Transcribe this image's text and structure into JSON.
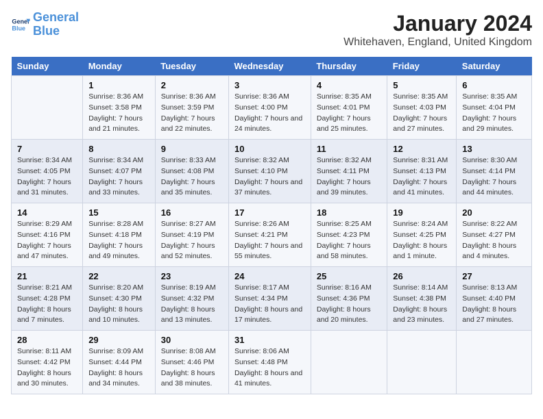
{
  "header": {
    "logo_line1": "General",
    "logo_line2": "Blue",
    "main_title": "January 2024",
    "subtitle": "Whitehaven, England, United Kingdom"
  },
  "columns": [
    "Sunday",
    "Monday",
    "Tuesday",
    "Wednesday",
    "Thursday",
    "Friday",
    "Saturday"
  ],
  "weeks": [
    [
      {
        "num": "",
        "sunrise": "",
        "sunset": "",
        "daylight": ""
      },
      {
        "num": "1",
        "sunrise": "Sunrise: 8:36 AM",
        "sunset": "Sunset: 3:58 PM",
        "daylight": "Daylight: 7 hours and 21 minutes."
      },
      {
        "num": "2",
        "sunrise": "Sunrise: 8:36 AM",
        "sunset": "Sunset: 3:59 PM",
        "daylight": "Daylight: 7 hours and 22 minutes."
      },
      {
        "num": "3",
        "sunrise": "Sunrise: 8:36 AM",
        "sunset": "Sunset: 4:00 PM",
        "daylight": "Daylight: 7 hours and 24 minutes."
      },
      {
        "num": "4",
        "sunrise": "Sunrise: 8:35 AM",
        "sunset": "Sunset: 4:01 PM",
        "daylight": "Daylight: 7 hours and 25 minutes."
      },
      {
        "num": "5",
        "sunrise": "Sunrise: 8:35 AM",
        "sunset": "Sunset: 4:03 PM",
        "daylight": "Daylight: 7 hours and 27 minutes."
      },
      {
        "num": "6",
        "sunrise": "Sunrise: 8:35 AM",
        "sunset": "Sunset: 4:04 PM",
        "daylight": "Daylight: 7 hours and 29 minutes."
      }
    ],
    [
      {
        "num": "7",
        "sunrise": "Sunrise: 8:34 AM",
        "sunset": "Sunset: 4:05 PM",
        "daylight": "Daylight: 7 hours and 31 minutes."
      },
      {
        "num": "8",
        "sunrise": "Sunrise: 8:34 AM",
        "sunset": "Sunset: 4:07 PM",
        "daylight": "Daylight: 7 hours and 33 minutes."
      },
      {
        "num": "9",
        "sunrise": "Sunrise: 8:33 AM",
        "sunset": "Sunset: 4:08 PM",
        "daylight": "Daylight: 7 hours and 35 minutes."
      },
      {
        "num": "10",
        "sunrise": "Sunrise: 8:32 AM",
        "sunset": "Sunset: 4:10 PM",
        "daylight": "Daylight: 7 hours and 37 minutes."
      },
      {
        "num": "11",
        "sunrise": "Sunrise: 8:32 AM",
        "sunset": "Sunset: 4:11 PM",
        "daylight": "Daylight: 7 hours and 39 minutes."
      },
      {
        "num": "12",
        "sunrise": "Sunrise: 8:31 AM",
        "sunset": "Sunset: 4:13 PM",
        "daylight": "Daylight: 7 hours and 41 minutes."
      },
      {
        "num": "13",
        "sunrise": "Sunrise: 8:30 AM",
        "sunset": "Sunset: 4:14 PM",
        "daylight": "Daylight: 7 hours and 44 minutes."
      }
    ],
    [
      {
        "num": "14",
        "sunrise": "Sunrise: 8:29 AM",
        "sunset": "Sunset: 4:16 PM",
        "daylight": "Daylight: 7 hours and 47 minutes."
      },
      {
        "num": "15",
        "sunrise": "Sunrise: 8:28 AM",
        "sunset": "Sunset: 4:18 PM",
        "daylight": "Daylight: 7 hours and 49 minutes."
      },
      {
        "num": "16",
        "sunrise": "Sunrise: 8:27 AM",
        "sunset": "Sunset: 4:19 PM",
        "daylight": "Daylight: 7 hours and 52 minutes."
      },
      {
        "num": "17",
        "sunrise": "Sunrise: 8:26 AM",
        "sunset": "Sunset: 4:21 PM",
        "daylight": "Daylight: 7 hours and 55 minutes."
      },
      {
        "num": "18",
        "sunrise": "Sunrise: 8:25 AM",
        "sunset": "Sunset: 4:23 PM",
        "daylight": "Daylight: 7 hours and 58 minutes."
      },
      {
        "num": "19",
        "sunrise": "Sunrise: 8:24 AM",
        "sunset": "Sunset: 4:25 PM",
        "daylight": "Daylight: 8 hours and 1 minute."
      },
      {
        "num": "20",
        "sunrise": "Sunrise: 8:22 AM",
        "sunset": "Sunset: 4:27 PM",
        "daylight": "Daylight: 8 hours and 4 minutes."
      }
    ],
    [
      {
        "num": "21",
        "sunrise": "Sunrise: 8:21 AM",
        "sunset": "Sunset: 4:28 PM",
        "daylight": "Daylight: 8 hours and 7 minutes."
      },
      {
        "num": "22",
        "sunrise": "Sunrise: 8:20 AM",
        "sunset": "Sunset: 4:30 PM",
        "daylight": "Daylight: 8 hours and 10 minutes."
      },
      {
        "num": "23",
        "sunrise": "Sunrise: 8:19 AM",
        "sunset": "Sunset: 4:32 PM",
        "daylight": "Daylight: 8 hours and 13 minutes."
      },
      {
        "num": "24",
        "sunrise": "Sunrise: 8:17 AM",
        "sunset": "Sunset: 4:34 PM",
        "daylight": "Daylight: 8 hours and 17 minutes."
      },
      {
        "num": "25",
        "sunrise": "Sunrise: 8:16 AM",
        "sunset": "Sunset: 4:36 PM",
        "daylight": "Daylight: 8 hours and 20 minutes."
      },
      {
        "num": "26",
        "sunrise": "Sunrise: 8:14 AM",
        "sunset": "Sunset: 4:38 PM",
        "daylight": "Daylight: 8 hours and 23 minutes."
      },
      {
        "num": "27",
        "sunrise": "Sunrise: 8:13 AM",
        "sunset": "Sunset: 4:40 PM",
        "daylight": "Daylight: 8 hours and 27 minutes."
      }
    ],
    [
      {
        "num": "28",
        "sunrise": "Sunrise: 8:11 AM",
        "sunset": "Sunset: 4:42 PM",
        "daylight": "Daylight: 8 hours and 30 minutes."
      },
      {
        "num": "29",
        "sunrise": "Sunrise: 8:09 AM",
        "sunset": "Sunset: 4:44 PM",
        "daylight": "Daylight: 8 hours and 34 minutes."
      },
      {
        "num": "30",
        "sunrise": "Sunrise: 8:08 AM",
        "sunset": "Sunset: 4:46 PM",
        "daylight": "Daylight: 8 hours and 38 minutes."
      },
      {
        "num": "31",
        "sunrise": "Sunrise: 8:06 AM",
        "sunset": "Sunset: 4:48 PM",
        "daylight": "Daylight: 8 hours and 41 minutes."
      },
      {
        "num": "",
        "sunrise": "",
        "sunset": "",
        "daylight": ""
      },
      {
        "num": "",
        "sunrise": "",
        "sunset": "",
        "daylight": ""
      },
      {
        "num": "",
        "sunrise": "",
        "sunset": "",
        "daylight": ""
      }
    ]
  ]
}
